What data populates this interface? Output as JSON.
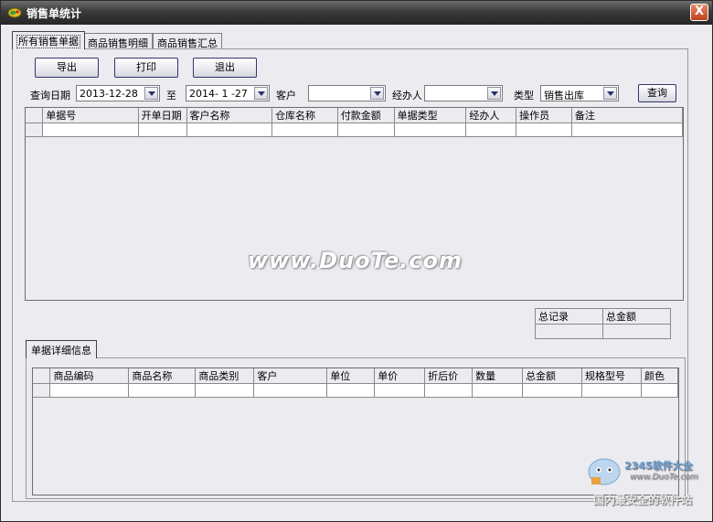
{
  "window": {
    "title": "销售单统计",
    "close_glyph": "X"
  },
  "tabs": [
    {
      "label": "所有销售单据"
    },
    {
      "label": "商品销售明细"
    },
    {
      "label": "商品销售汇总"
    }
  ],
  "toolbar": {
    "export_label": "导出",
    "print_label": "打印",
    "exit_label": "退出"
  },
  "filters": {
    "date_label": "查询日期",
    "date_from": "2013-12-28",
    "to_label": "至",
    "date_to": "2014- 1 -27",
    "customer_label": "客户",
    "customer_value": "",
    "handler_label": "经办人",
    "handler_value": "",
    "type_label": "类型",
    "type_value": "销售出库",
    "query_label": "查询"
  },
  "orders_table": {
    "columns": [
      "单据号",
      "开单日期",
      "客户名称",
      "仓库名称",
      "付款金额",
      "单据类型",
      "经办人",
      "操作员",
      "备注"
    ]
  },
  "summary": {
    "total_records_label": "总记录",
    "total_amount_label": "总金额"
  },
  "detail_tab": {
    "label": "单据详细信息"
  },
  "detail_table": {
    "columns": [
      "商品编码",
      "商品名称",
      "商品类别",
      "客户",
      "单位",
      "单价",
      "折后价",
      "数量",
      "总金额",
      "规格型号",
      "颜色"
    ]
  },
  "watermarks": {
    "center": "www.DuoTe.com",
    "corner_brand": "2345软件大全",
    "corner_url": "www.DuoTe.com",
    "corner_slogan": "国内最安全的软件站"
  }
}
